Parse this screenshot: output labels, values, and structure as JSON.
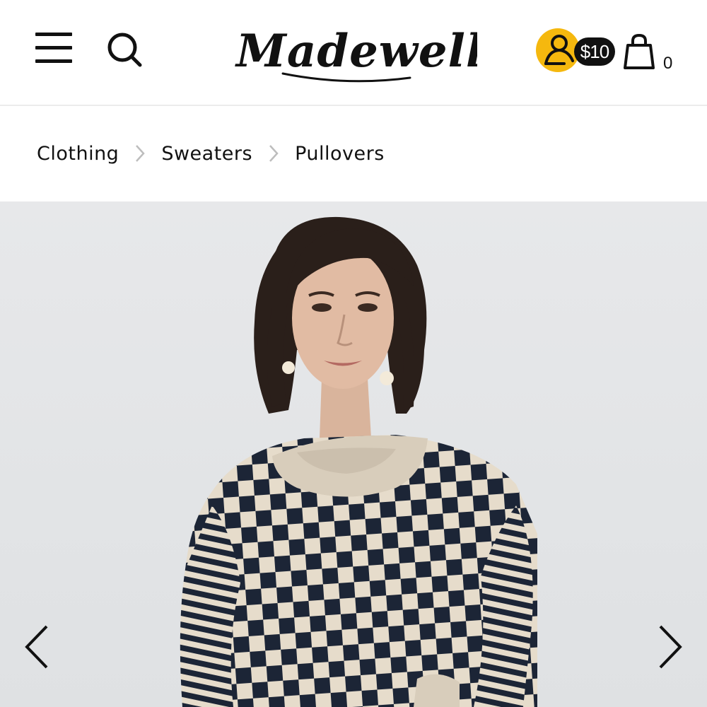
{
  "header": {
    "brand": "Madewell",
    "rewards_amount": "$10",
    "cart_count": "0",
    "icons": [
      "hamburger-menu-icon",
      "search-icon",
      "account-icon",
      "shopping-bag-icon"
    ],
    "accent_color": "#f5b80e"
  },
  "breadcrumb": {
    "items": [
      "Clothing",
      "Sweaters",
      "Pullovers"
    ]
  },
  "product_gallery": {
    "icons": [
      "chevron-left-icon",
      "chevron-right-icon"
    ],
    "image_subject": "model wearing checkerboard pullover sweater"
  }
}
